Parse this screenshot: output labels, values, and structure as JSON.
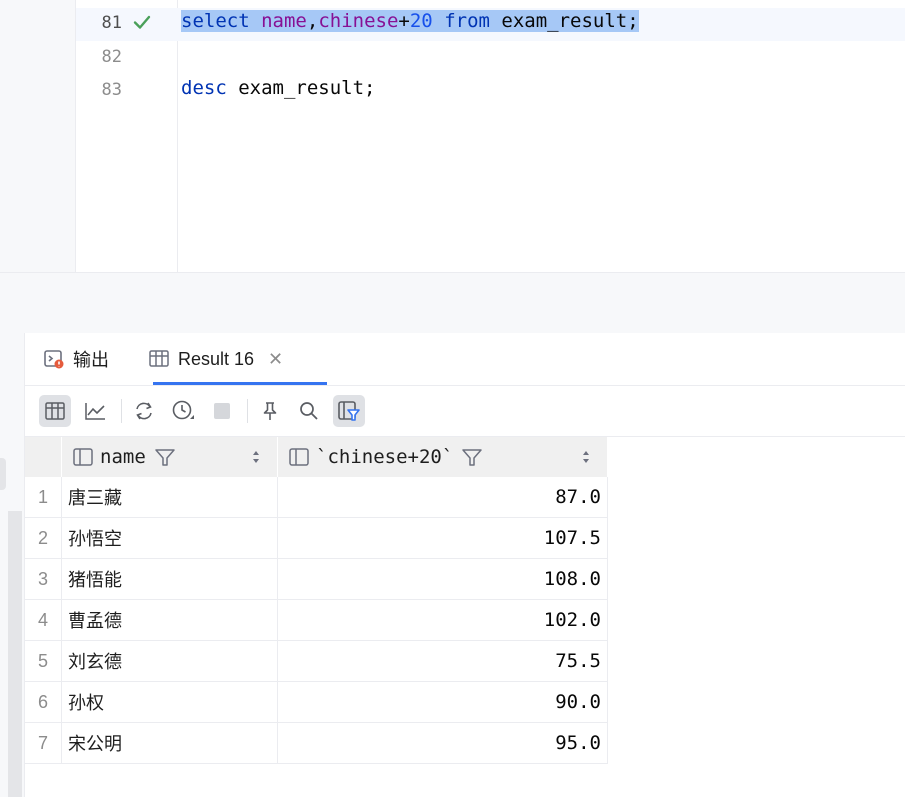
{
  "editor": {
    "lines": [
      {
        "number": "81"
      },
      {
        "number": "82"
      },
      {
        "number": "83"
      }
    ],
    "line81": {
      "kw_select": "select",
      "id_name": "name",
      "comma": ",",
      "id_chinese": "chinese",
      "plus": "+",
      "num": "20",
      "kw_from": "from",
      "rest": "exam_result;"
    },
    "line83": {
      "kw_desc": "desc",
      "rest": "exam_result;"
    }
  },
  "panel": {
    "tabs": [
      {
        "label": "输出",
        "icon": "console-icon"
      },
      {
        "label": "Result 16",
        "icon": "table-icon",
        "active": true
      }
    ],
    "toolbar": [
      "table-view-icon",
      "chart-icon",
      "refresh-icon",
      "history-icon",
      "stop-icon",
      "pin-icon",
      "search-icon",
      "filter-view-icon"
    ]
  },
  "table": {
    "columns": [
      "name",
      "`chinese+20`"
    ],
    "rows": [
      {
        "n": "1",
        "name": "唐三藏",
        "value": "87.0"
      },
      {
        "n": "2",
        "name": "孙悟空",
        "value": "107.5"
      },
      {
        "n": "3",
        "name": "猪悟能",
        "value": "108.0"
      },
      {
        "n": "4",
        "name": "曹孟德",
        "value": "102.0"
      },
      {
        "n": "5",
        "name": "刘玄德",
        "value": "75.5"
      },
      {
        "n": "6",
        "name": "孙权",
        "value": "90.0"
      },
      {
        "n": "7",
        "name": "宋公明",
        "value": "95.0"
      }
    ]
  },
  "colors": {
    "accent": "#3574f0",
    "selection": "#a6c8f6",
    "keyword": "#0033b3",
    "identifier": "#871094",
    "number": "#1750eb",
    "check": "#4aa05a"
  }
}
